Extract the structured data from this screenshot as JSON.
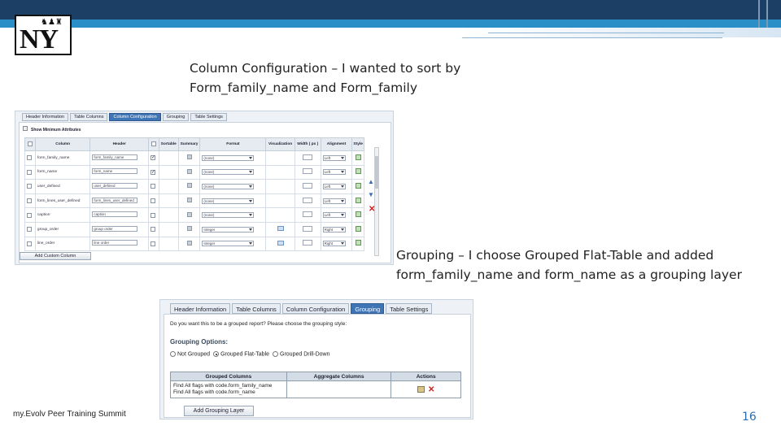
{
  "slide": {
    "title_text": "Column Configuration – I wanted to sort by Form_family_name and Form_family",
    "title_line1": "Column Configuration – I wanted to sort by",
    "title_line2": "Form_family_name and Form_family",
    "grouping_line1": "Grouping – I choose Grouped Flat-Table and added",
    "grouping_line2": "form_family_name and form_name as a grouping layer",
    "footer": "my.Evolv Peer Training Summit",
    "page_number": "16",
    "logo_text": "NY",
    "colors": {
      "banner": "#1c3f66",
      "accent": "#2a8fc7",
      "page_number": "#2a6db0"
    }
  },
  "column_config": {
    "tabs": [
      "Header Information",
      "Table Columns",
      "Column Configuration",
      "Grouping",
      "Table Settings"
    ],
    "active_tab": "Column Configuration",
    "show_minimum": "Show Minimum Attributes",
    "headers": [
      "",
      "Column",
      "Header",
      "",
      "Sortable",
      "Summary",
      "Format",
      "Visualization",
      "Width ( px )",
      "Alignment",
      "Style"
    ],
    "rows": [
      {
        "column": "form_family_name",
        "header": "form_family_name",
        "sortable": true,
        "format": "(none)",
        "alignment": "Left"
      },
      {
        "column": "form_name",
        "header": "form_name",
        "sortable": true,
        "format": "(none)",
        "alignment": "Left"
      },
      {
        "column": "user_defined",
        "header": "user_defined",
        "sortable": false,
        "format": "(none)",
        "alignment": "Left"
      },
      {
        "column": "form_lines_user_defined",
        "header": "form_lines_user_defined",
        "sortable": false,
        "format": "(none)",
        "alignment": "Left"
      },
      {
        "column": "caption",
        "header": "caption",
        "sortable": false,
        "format": "(none)",
        "alignment": "Left"
      },
      {
        "column": "group_order",
        "header": "group order",
        "sortable": false,
        "format": "Integer",
        "alignment": "Right"
      },
      {
        "column": "line_order",
        "header": "line order",
        "sortable": false,
        "format": "Integer",
        "alignment": "Right"
      }
    ],
    "add_button": "Add Custom Column",
    "icons": [
      "move-up-icon",
      "move-down-icon",
      "delete-icon"
    ]
  },
  "grouping": {
    "tabs": [
      "Header Information",
      "Table Columns",
      "Column Configuration",
      "Grouping",
      "Table Settings"
    ],
    "active_tab": "Grouping",
    "question": "Do you want this to be a grouped report? Please choose the grouping style:",
    "options_label": "Grouping Options:",
    "options": [
      "Not Grouped",
      "Grouped Flat-Table",
      "Grouped Drill-Down"
    ],
    "selected_option": "Grouped Flat-Table",
    "table_headers": [
      "Grouped Columns",
      "Aggregate Columns",
      "Actions"
    ],
    "grouped_columns": [
      "Find All flags with code.form_family_name",
      "Find All flags with code.form_name"
    ],
    "add_button": "Add Grouping Layer"
  }
}
